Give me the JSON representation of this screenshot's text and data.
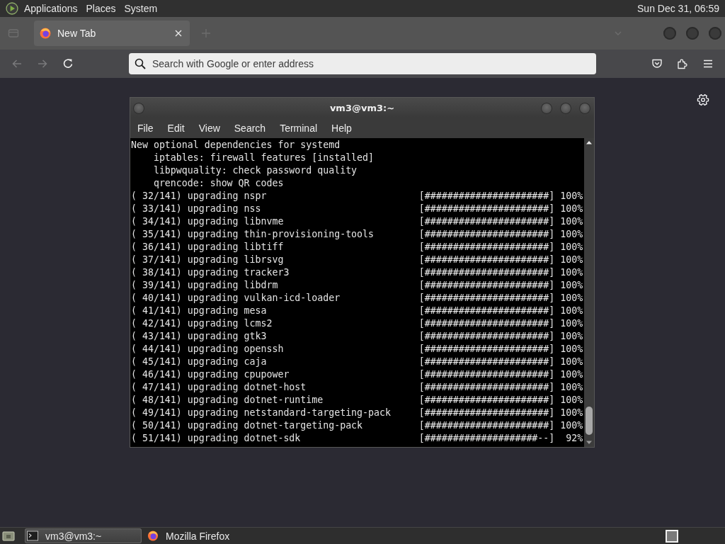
{
  "top_panel": {
    "menus": [
      "Applications",
      "Places",
      "System"
    ],
    "clock": "Sun Dec 31, 06:59"
  },
  "browser": {
    "tabs": [
      {
        "title": "New Tab",
        "selected": true
      }
    ],
    "nav": [
      {
        "kind": "back",
        "disabled": true
      },
      {
        "kind": "forward",
        "disabled": true
      },
      {
        "kind": "reload",
        "disabled": false
      }
    ],
    "address_bar": {
      "placeholder": "Search with Google or enter address"
    }
  },
  "terminal": {
    "title": "vm3@vm3:~",
    "menu": [
      "File",
      "Edit",
      "View",
      "Search",
      "Terminal",
      "Help"
    ],
    "lines": [
      {
        "kind": "text",
        "text": "New optional dependencies for systemd",
        "children": [
          {
            "text": "iptables: firewall features [installed]"
          },
          {
            "text": "libpwquality: check password quality"
          },
          {
            "text": "qrencode: show QR codes"
          }
        ]
      },
      {
        "kind": "progress",
        "text": "( 32/141) upgrading nspr",
        "bar": "[######################]",
        "percent": "100%"
      },
      {
        "kind": "progress",
        "text": "( 33/141) upgrading nss",
        "bar": "[######################]",
        "percent": "100%"
      },
      {
        "kind": "progress",
        "text": "( 34/141) upgrading libnvme",
        "bar": "[######################]",
        "percent": "100%"
      },
      {
        "kind": "progress",
        "text": "( 35/141) upgrading thin-provisioning-tools",
        "bar": "[######################]",
        "percent": "100%"
      },
      {
        "kind": "progress",
        "text": "( 36/141) upgrading libtiff",
        "bar": "[######################]",
        "percent": "100%"
      },
      {
        "kind": "progress",
        "text": "( 37/141) upgrading librsvg",
        "bar": "[######################]",
        "percent": "100%"
      },
      {
        "kind": "progress",
        "text": "( 38/141) upgrading tracker3",
        "bar": "[######################]",
        "percent": "100%"
      },
      {
        "kind": "progress",
        "text": "( 39/141) upgrading libdrm",
        "bar": "[######################]",
        "percent": "100%"
      },
      {
        "kind": "progress",
        "text": "( 40/141) upgrading vulkan-icd-loader",
        "bar": "[######################]",
        "percent": "100%"
      },
      {
        "kind": "progress",
        "text": "( 41/141) upgrading mesa",
        "bar": "[######################]",
        "percent": "100%"
      },
      {
        "kind": "progress",
        "text": "( 42/141) upgrading lcms2",
        "bar": "[######################]",
        "percent": "100%"
      },
      {
        "kind": "progress",
        "text": "( 43/141) upgrading gtk3",
        "bar": "[######################]",
        "percent": "100%"
      },
      {
        "kind": "progress",
        "text": "( 44/141) upgrading openssh",
        "bar": "[######################]",
        "percent": "100%"
      },
      {
        "kind": "progress",
        "text": "( 45/141) upgrading caja",
        "bar": "[######################]",
        "percent": "100%"
      },
      {
        "kind": "progress",
        "text": "( 46/141) upgrading cpupower",
        "bar": "[######################]",
        "percent": "100%"
      },
      {
        "kind": "progress",
        "text": "( 47/141) upgrading dotnet-host",
        "bar": "[######################]",
        "percent": "100%"
      },
      {
        "kind": "progress",
        "text": "( 48/141) upgrading dotnet-runtime",
        "bar": "[######################]",
        "percent": "100%"
      },
      {
        "kind": "progress",
        "text": "( 49/141) upgrading netstandard-targeting-pack",
        "bar": "[######################]",
        "percent": "100%"
      },
      {
        "kind": "progress",
        "text": "( 50/141) upgrading dotnet-targeting-pack",
        "bar": "[######################]",
        "percent": "100%"
      },
      {
        "kind": "progress",
        "text": "( 51/141) upgrading dotnet-sdk",
        "bar": "[####################--]",
        "percent": "92%"
      }
    ]
  },
  "taskbar": {
    "tasks": [
      {
        "kind": "terminal",
        "label": "vm3@vm3:~",
        "selected": true
      },
      {
        "kind": "browser",
        "label": "Mozilla Firefox",
        "selected": false
      }
    ]
  }
}
